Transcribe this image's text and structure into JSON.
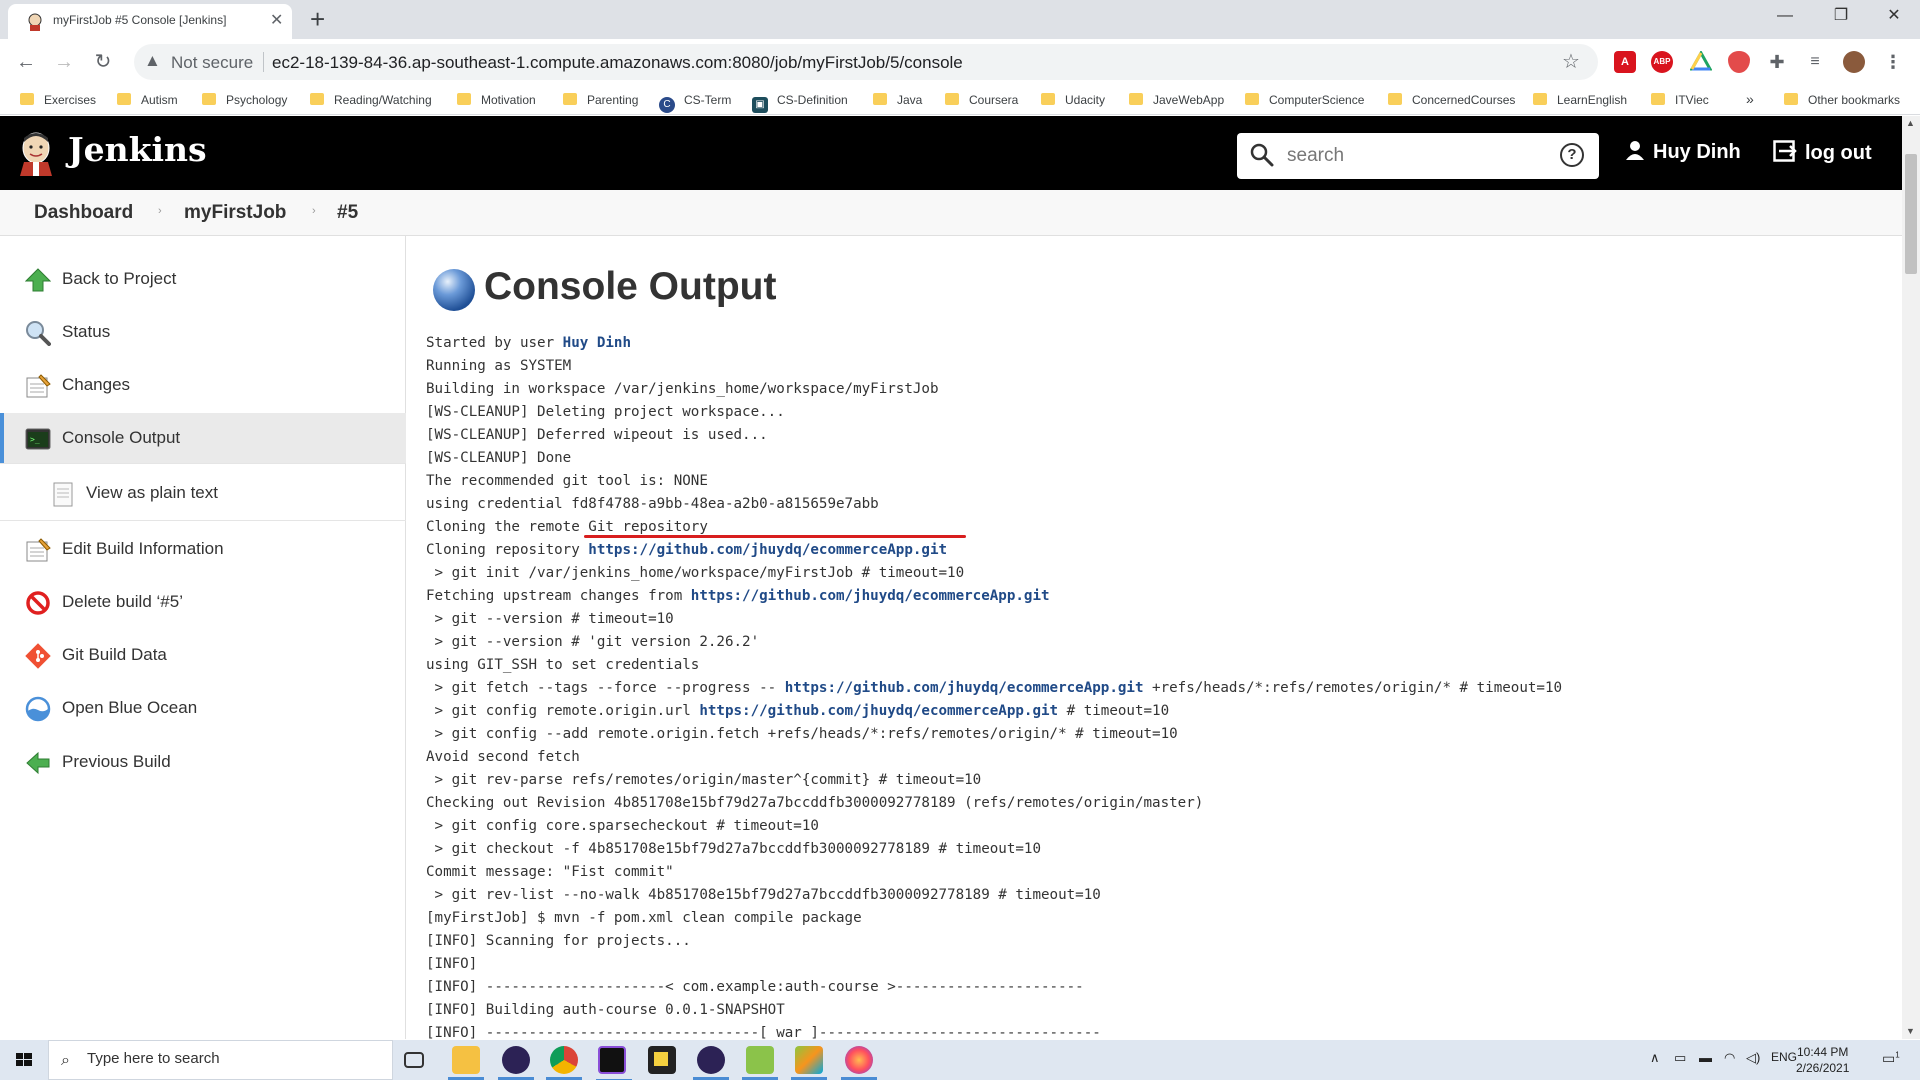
{
  "browser": {
    "tab_title": "myFirstJob #5 Console [Jenkins]",
    "tab_close": "✕",
    "new_tab": "+",
    "security_label": "Not secure",
    "url": "ec2-18-139-84-36.ap-southeast-1.compute.amazonaws.com:8080/job/myFirstJob/5/console",
    "extensions": [
      "acrobat-icon",
      "adblock-plus-icon",
      "google-drive-icon",
      "ublock-icon",
      "puzzle-icon",
      "reading-list-icon",
      "profile-avatar"
    ],
    "extension_labels": {
      "abp": "ABP"
    },
    "bookmarks": [
      "Exercises",
      "Autism",
      "Psychology",
      "Reading/Watching",
      "Motivation",
      "Parenting",
      "CS-Term",
      "CS-Definition",
      "Java",
      "Coursera",
      "Udacity",
      "JaveWebApp",
      "ComputerScience",
      "ConcernedCourses",
      "LearnEnglish",
      "ITViec"
    ],
    "bookmarks_more": "»",
    "other_bookmarks": "Other bookmarks"
  },
  "jenkins": {
    "title": "Jenkins",
    "search_placeholder": "search",
    "help": "?",
    "user": "Huy Dinh",
    "logout": "log out",
    "breadcrumbs": [
      "Dashboard",
      "myFirstJob",
      "#5"
    ],
    "sidebar": [
      {
        "label": "Back to Project",
        "icon": "up-arrow-icon"
      },
      {
        "label": "Status",
        "icon": "magnifier-icon"
      },
      {
        "label": "Changes",
        "icon": "notepad-icon"
      },
      {
        "label": "Console Output",
        "icon": "terminal-icon",
        "active": true
      },
      {
        "label": "View as plain text",
        "icon": "document-icon"
      },
      {
        "label": "Edit Build Information",
        "icon": "notepad-icon"
      },
      {
        "label": "Delete build ‘#5’",
        "icon": "no-entry-icon"
      },
      {
        "label": "Git Build Data",
        "icon": "git-icon"
      },
      {
        "label": "Open Blue Ocean",
        "icon": "blue-ocean-icon"
      },
      {
        "label": "Previous Build",
        "icon": "left-arrow-icon"
      }
    ],
    "page_title": "Console Output",
    "started_by_prefix": "Started by user ",
    "started_by_user": "Huy Dinh",
    "repo_url": "https://github.com/jhuydq/ecommerceApp.git",
    "console_lines": [
      "Running as SYSTEM",
      "Building in workspace /var/jenkins_home/workspace/myFirstJob",
      "[WS-CLEANUP] Deleting project workspace...",
      "[WS-CLEANUP] Deferred wipeout is used...",
      "[WS-CLEANUP] Done",
      "The recommended git tool is: NONE",
      "using credential fd8f4788-a9bb-48ea-a2b0-a815659e7abb",
      "Cloning the remote Git repository"
    ],
    "cloning_prefix": "Cloning repository ",
    "git_init": " > git init /var/jenkins_home/workspace/myFirstJob # timeout=10",
    "fetching_prefix": "Fetching upstream changes from ",
    "lines_b": [
      " > git --version # timeout=10",
      " > git --version # 'git version 2.26.2'",
      "using GIT_SSH to set credentials"
    ],
    "fetch_prefix": " > git fetch --tags --force --progress -- ",
    "fetch_suffix": " +refs/heads/*:refs/remotes/origin/* # timeout=10",
    "config_prefix": " > git config remote.origin.url ",
    "config_suffix": " # timeout=10",
    "lines_c": [
      " > git config --add remote.origin.fetch +refs/heads/*:refs/remotes/origin/* # timeout=10",
      "Avoid second fetch",
      " > git rev-parse refs/remotes/origin/master^{commit} # timeout=10",
      "Checking out Revision 4b851708e15bf79d27a7bccddfb3000092778189 (refs/remotes/origin/master)",
      " > git config core.sparsecheckout # timeout=10",
      " > git checkout -f 4b851708e15bf79d27a7bccddfb3000092778189 # timeout=10",
      "Commit message: \"Fist commit\"",
      " > git rev-list --no-walk 4b851708e15bf79d27a7bccddfb3000092778189 # timeout=10",
      "[myFirstJob] $ mvn -f pom.xml clean compile package",
      "[INFO] Scanning for projects...",
      "[INFO]",
      "[INFO] ---------------------< com.example:auth-course >----------------------",
      "[INFO] Building auth-course 0.0.1-SNAPSHOT",
      "[INFO] --------------------------------[ war ]---------------------------------"
    ]
  },
  "taskbar": {
    "search_placeholder": "Type here to search",
    "apps": [
      "task-view-icon",
      "file-explorer-icon",
      "eclipse-icon",
      "chrome-icon",
      "intellij-icon",
      "sticky-notes-icon",
      "eclipse-icon",
      "notepad-plus-icon",
      "sourcetree-icon",
      "firefox-icon"
    ],
    "language": "ENG",
    "time": "10:44 PM",
    "date": "2/26/2021",
    "notifications": "1"
  },
  "colors": {
    "jenkins_header": "#000000",
    "link": "#204a87",
    "highlight_underline": "#d81e1e",
    "active_border": "#4a90d9"
  }
}
